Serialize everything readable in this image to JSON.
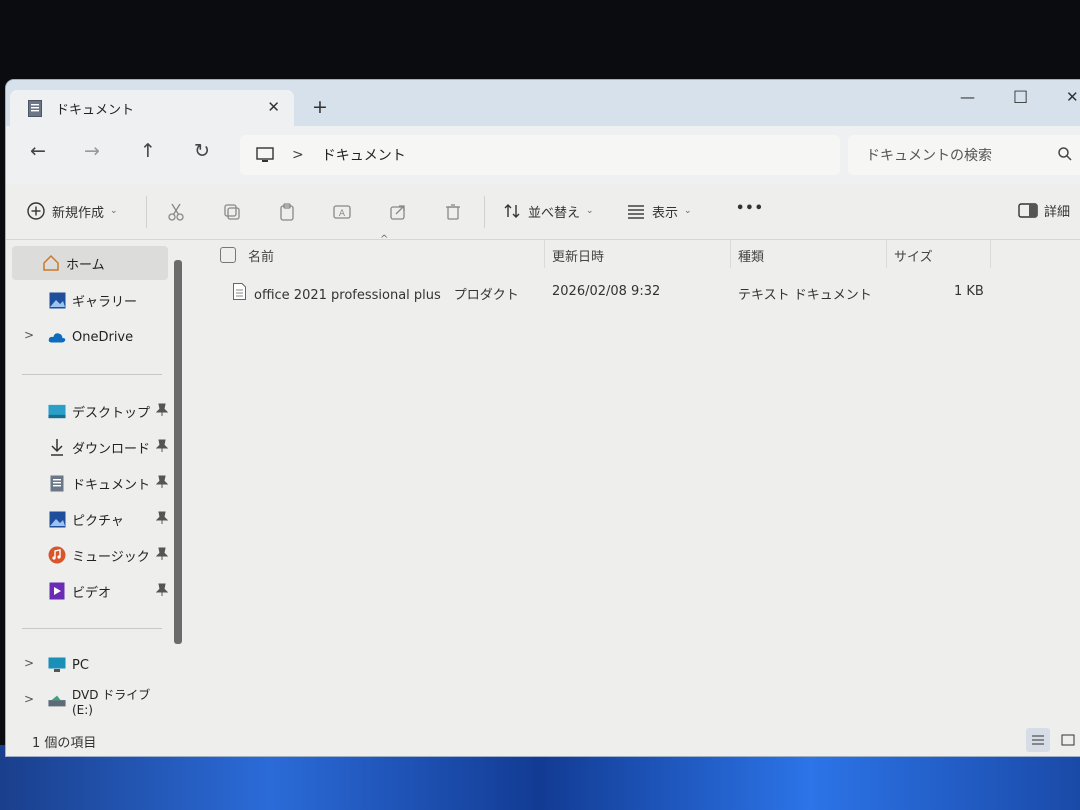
{
  "tab": {
    "title": "ドキュメント",
    "close": "✕",
    "new_tab": "+"
  },
  "window_controls": {
    "minimize": "—",
    "maximize": "☐",
    "close": "✕"
  },
  "nav": {
    "back": "←",
    "forward": "→",
    "up": "↑",
    "refresh": "↻",
    "breadcrumb": [
      "ドキュメント"
    ],
    "search_placeholder": "ドキュメントの検索"
  },
  "toolbar": {
    "new_label": "新規作成",
    "sort_label": "並べ替え",
    "view_label": "表示",
    "more": "•••",
    "details_label": "詳細"
  },
  "sidebar": {
    "items": [
      {
        "label": "ホーム",
        "icon": "home-icon"
      },
      {
        "label": "ギャラリー",
        "icon": "gallery-icon"
      },
      {
        "label": "OneDrive",
        "icon": "cloud-icon"
      }
    ],
    "pinned": [
      {
        "label": "デスクトップ",
        "icon": "desktop-icon"
      },
      {
        "label": "ダウンロード",
        "icon": "download-icon"
      },
      {
        "label": "ドキュメント",
        "icon": "document-icon"
      },
      {
        "label": "ピクチャ",
        "icon": "pictures-icon"
      },
      {
        "label": "ミュージック",
        "icon": "music-icon"
      },
      {
        "label": "ビデオ",
        "icon": "video-icon"
      }
    ],
    "devices": [
      {
        "label": "PC",
        "icon": "pc-icon"
      },
      {
        "label": "DVD ドライブ (E:)",
        "icon": "dvd-icon"
      }
    ]
  },
  "columns": {
    "name": "名前",
    "modified": "更新日時",
    "type": "種類",
    "size": "サイズ"
  },
  "files": [
    {
      "name": "office 2021 professional plus　プロダクト",
      "modified": "2026/02/08 9:32",
      "type": "テキスト ドキュメント",
      "size": "1 KB"
    }
  ],
  "status": {
    "item_count": "1 個の項目"
  },
  "colors": {
    "accent": "#0067c0",
    "titlebar": "#d7e1ec",
    "window": "#eeeeec"
  }
}
